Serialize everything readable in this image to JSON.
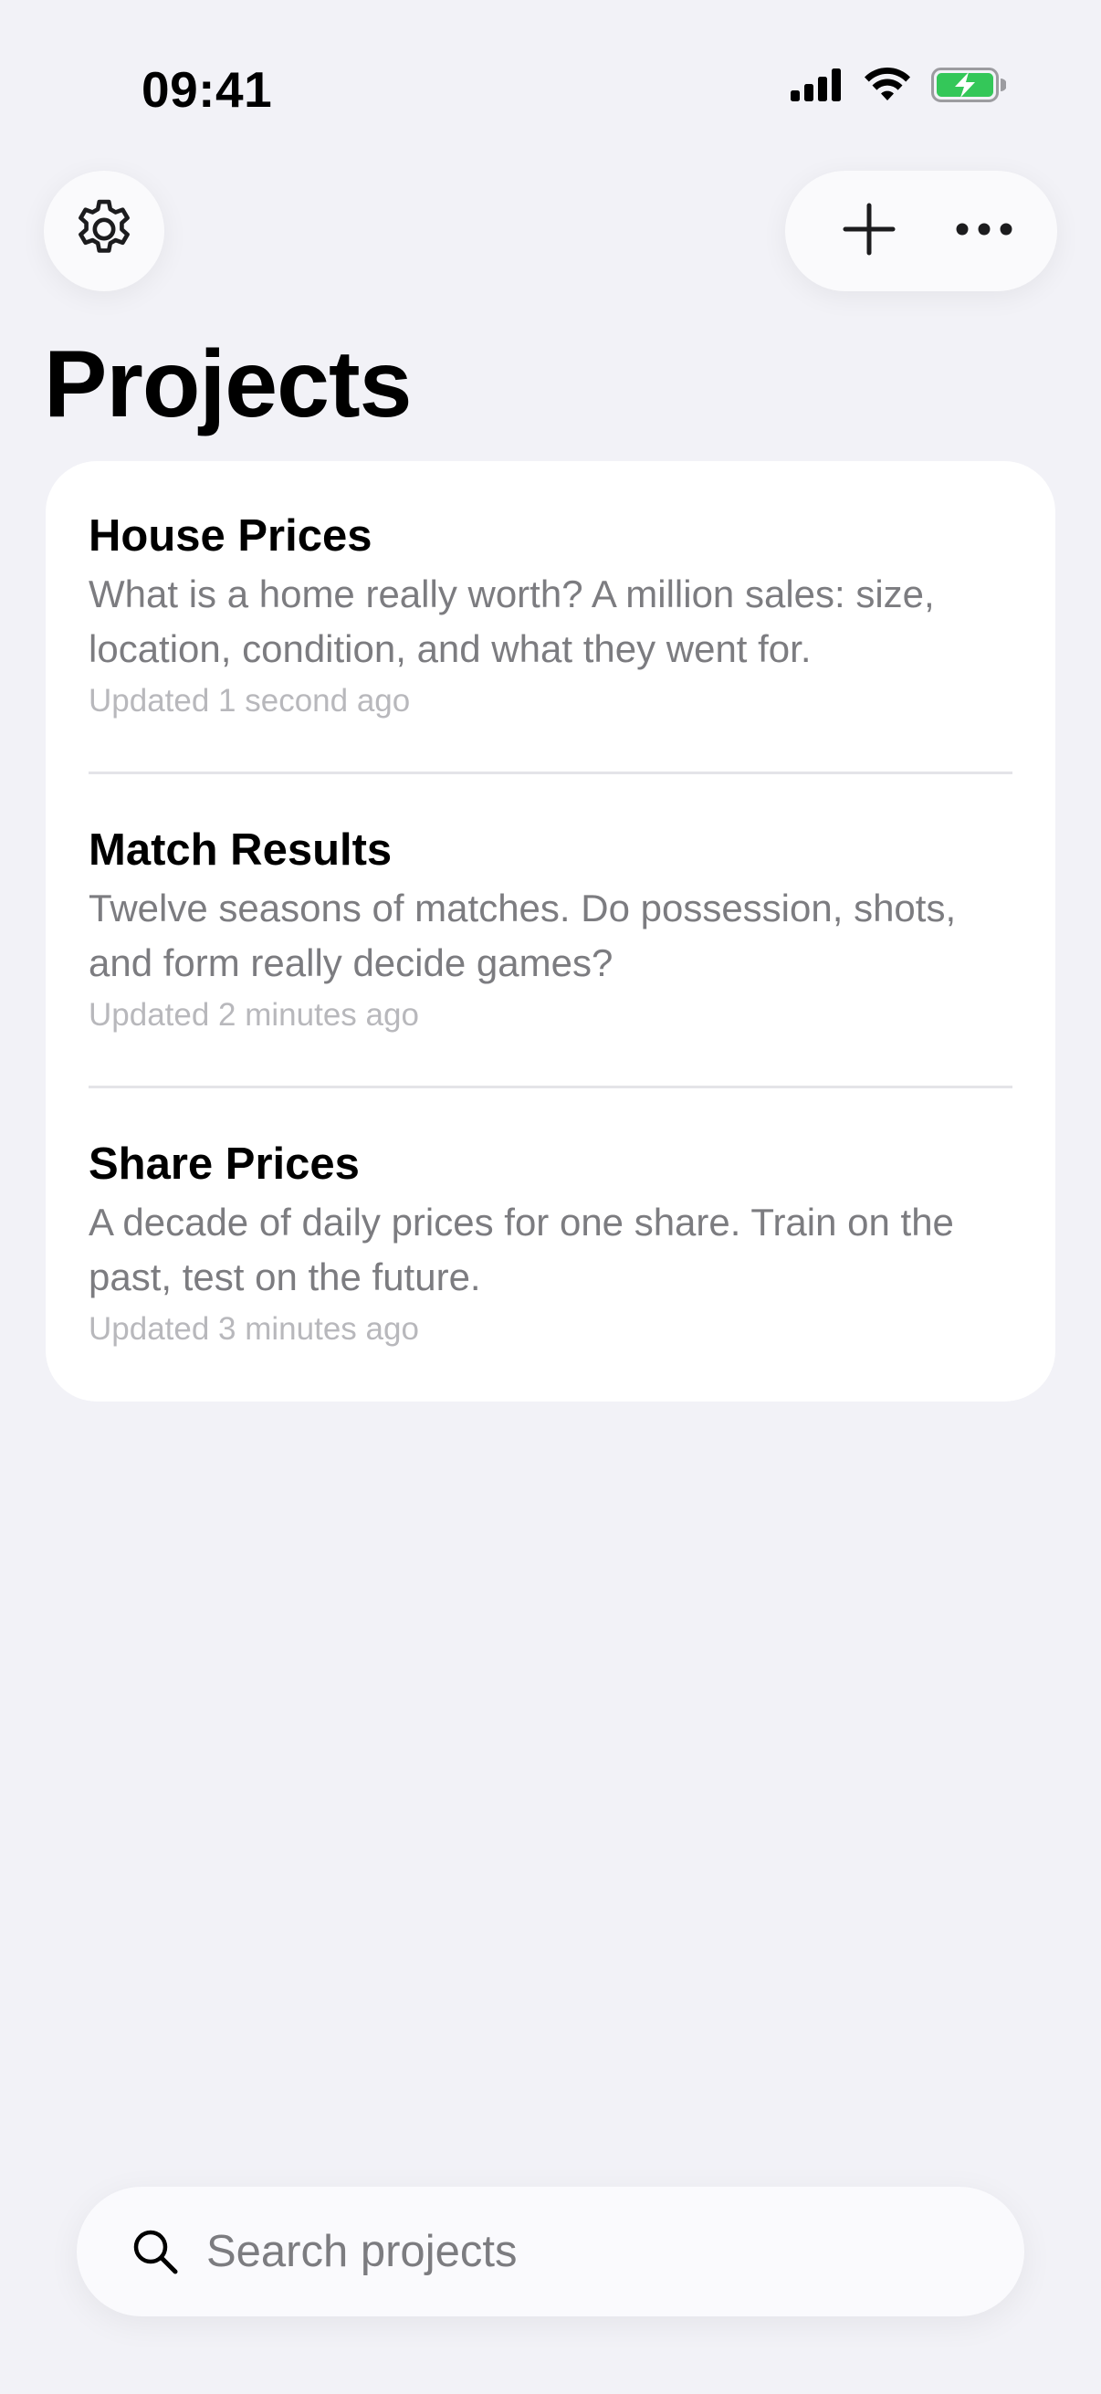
{
  "status_bar": {
    "time": "09:41",
    "icons": [
      "cellular-signal-icon",
      "wifi-icon",
      "battery-charging-icon"
    ],
    "battery_color": "#34C759"
  },
  "toolbar": {
    "settings_icon": "gear-icon",
    "add_icon": "plus-icon",
    "more_icon": "ellipsis-icon"
  },
  "page": {
    "title": "Projects"
  },
  "projects": [
    {
      "title": "House Prices",
      "description": "What is a home really worth? A million sales: size, location, condition, and what they went for.",
      "updated": "Updated 1 second ago"
    },
    {
      "title": "Match Results",
      "description": "Twelve seasons of matches. Do possession, shots, and form really decide games?",
      "updated": "Updated 2 minutes ago"
    },
    {
      "title": "Share Prices",
      "description": "A decade of daily prices for one share. Train on the past, test on the future.",
      "updated": "Updated 3 minutes ago"
    }
  ],
  "search": {
    "icon": "search-icon",
    "placeholder": "Search projects",
    "value": ""
  },
  "colors": {
    "background": "#F2F2F7",
    "card": "#FFFFFF",
    "secondary_text": "#7C7C80",
    "tertiary_text": "#B8B8BC"
  }
}
